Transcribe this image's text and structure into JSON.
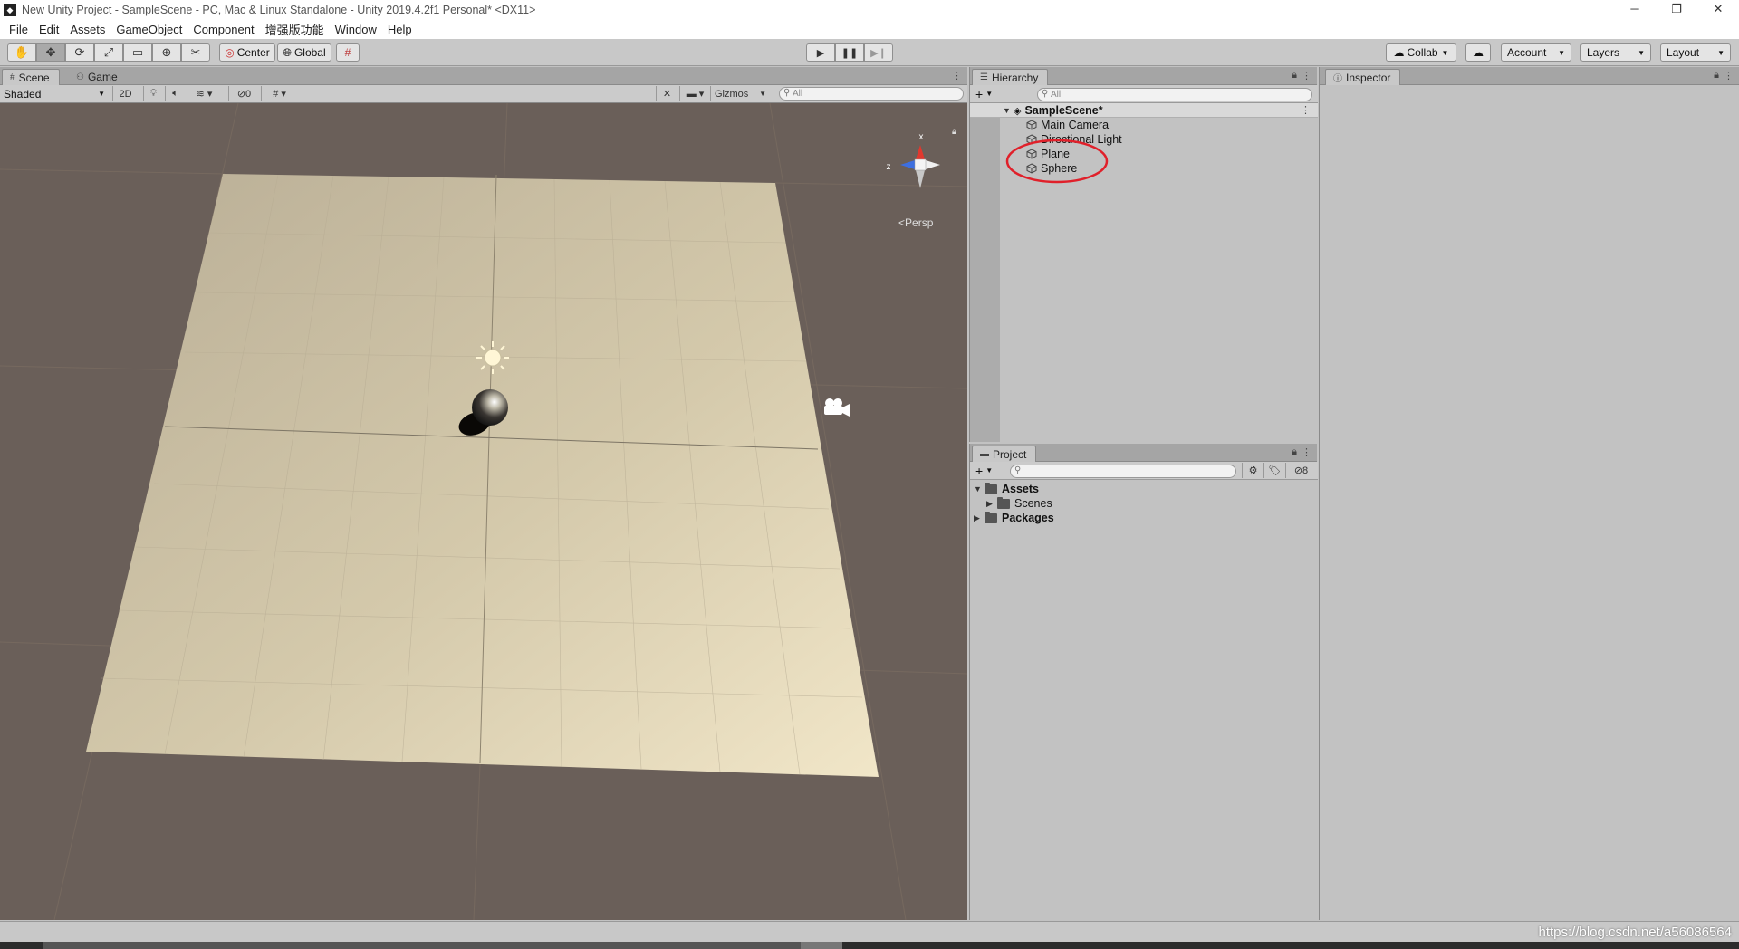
{
  "window": {
    "title": "New Unity Project - SampleScene - PC, Mac & Linux Standalone - Unity 2019.4.2f1 Personal* <DX11>",
    "controls": [
      "─",
      "❐",
      "✕"
    ]
  },
  "menu": [
    "File",
    "Edit",
    "Assets",
    "GameObject",
    "Component",
    "增强版功能",
    "Window",
    "Help"
  ],
  "toolbar": {
    "pivot_label": "Center",
    "space_label": "Global",
    "collab_label": "Collab",
    "account_label": "Account",
    "layers_label": "Layers",
    "layout_label": "Layout"
  },
  "scene": {
    "tab_scene": "Scene",
    "tab_game": "Game",
    "shading_mode": "Shaded",
    "toggle_2d": "2D",
    "hidden_count": "0",
    "gizmos_label": "Gizmos",
    "search_placeholder": "All",
    "axis_x": "x",
    "axis_z": "z",
    "projection_label": "Persp"
  },
  "hierarchy": {
    "tab_label": "Hierarchy",
    "search_placeholder": "All",
    "scene_name": "SampleScene*",
    "items": [
      {
        "label": "Main Camera"
      },
      {
        "label": "Directional Light"
      },
      {
        "label": "Plane"
      },
      {
        "label": "Sphere"
      }
    ]
  },
  "project": {
    "tab_label": "Project",
    "search_placeholder": "",
    "hidden_count": "8",
    "tree": [
      {
        "label": "Assets",
        "expanded": true
      },
      {
        "label": "Scenes",
        "expanded": false
      },
      {
        "label": "Packages",
        "expanded": false
      }
    ]
  },
  "inspector": {
    "tab_label": "Inspector"
  },
  "watermark": "https://blog.csdn.net/a56086564",
  "colors": {
    "viewport_bg": "#6a5f59",
    "plane": "#d8cdb0",
    "highlight_ellipse": "#e0202a",
    "panel_bg": "#c2c2c2"
  }
}
